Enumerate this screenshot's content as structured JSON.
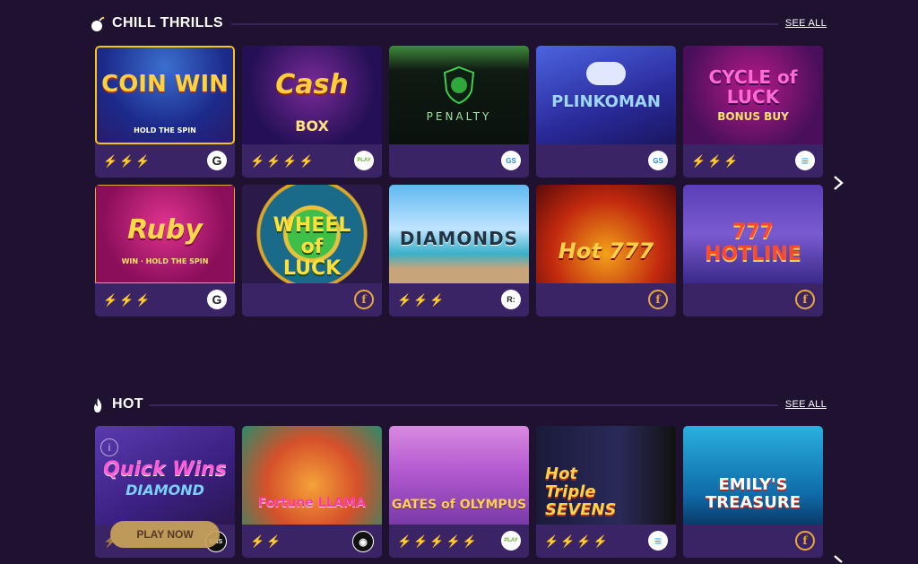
{
  "sections": [
    {
      "title": "CHILL THRILLS",
      "see_all": "SEE ALL",
      "games": [
        {
          "art_text": "COIN WIN",
          "art_sub": "HOLD THE SPIN",
          "bolts": "⚡⚡⚡",
          "provider": "G"
        },
        {
          "art_text": "Cash",
          "art_sub": "BOX",
          "bolts": "⚡⚡⚡⚡",
          "provider": "PLAY"
        },
        {
          "art_text": "PENALTY",
          "art_sub": "",
          "bolts": "",
          "provider": "GS"
        },
        {
          "art_text": "PLINKOMAN",
          "art_sub": "",
          "bolts": "",
          "provider": "GS"
        },
        {
          "art_text": "CYCLE of LUCK",
          "art_sub": "BONUS BUY",
          "bolts": "⚡⚡⚡",
          "provider": "≡"
        },
        {
          "art_text": "Ruby",
          "art_sub": "WIN · HOLD THE SPIN",
          "bolts": "⚡⚡⚡",
          "provider": "G"
        },
        {
          "art_text": "WHEEL of LUCK",
          "art_sub": "",
          "bolts": "",
          "provider": "f"
        },
        {
          "art_text": "DIAMONDS",
          "art_sub": "",
          "bolts": "⚡⚡⚡",
          "provider": "R:"
        },
        {
          "art_text": "Hot 777",
          "art_sub": "",
          "bolts": "",
          "provider": "f"
        },
        {
          "art_text": "777 HOTLINE",
          "art_sub": "",
          "bolts": "",
          "provider": "f"
        }
      ]
    },
    {
      "title": "HOT",
      "see_all": "SEE ALL",
      "games": [
        {
          "art_text": "Quick Wins",
          "art_sub": "DIAMOND",
          "bolts": "⚡",
          "provider": "ENS",
          "play_now": "PLAY NOW",
          "info": "i"
        },
        {
          "art_text": "Fortune LLAMA",
          "art_sub": "",
          "bolts": "⚡⚡",
          "provider": "◉"
        },
        {
          "art_text": "GATES of OLYMPUS",
          "art_sub": "",
          "bolts": "⚡⚡⚡⚡⚡",
          "provider": "PLAY"
        },
        {
          "art_text": "Hot Triple SEVENS",
          "art_sub": "",
          "bolts": "⚡⚡⚡⚡",
          "provider": "≡"
        },
        {
          "art_text": "EMILY'S TREASURE",
          "art_sub": "",
          "bolts": "",
          "provider": "f"
        }
      ]
    }
  ],
  "colors": {
    "background": "#1f1231",
    "card": "#3b2466",
    "bolt": "#f5b82a",
    "accent": "#e8a93a"
  },
  "icons": {
    "chill": "bomb-icon",
    "hot": "flame-icon",
    "next": "chevron-right-icon"
  }
}
